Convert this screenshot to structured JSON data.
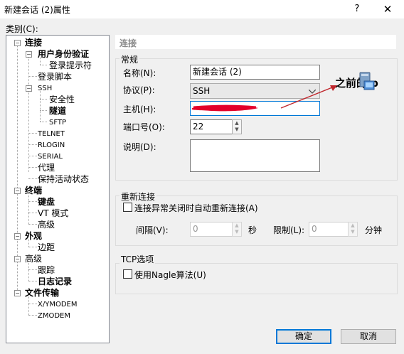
{
  "window": {
    "title": "新建会话 (2)属性",
    "help": "?",
    "close": "✕"
  },
  "category_label": "类别(C):",
  "tree": {
    "connection": "连接",
    "user_auth": "用户身份验证",
    "login_prompts": "登录提示符",
    "login_scripts": "登录脚本",
    "ssh": "SSH",
    "security": "安全性",
    "tunneling": "隧道",
    "sftp": "SFTP",
    "telnet": "TELNET",
    "rlogin": "RLOGIN",
    "serial": "SERIAL",
    "proxy": "代理",
    "keepalive": "保持活动状态",
    "terminal": "终端",
    "keyboard": "键盘",
    "vt_modes": "VT 模式",
    "advanced": "高级",
    "appearance": "外观",
    "margins": "边距",
    "advanced2": "高级",
    "trace": "跟踪",
    "logging": "日志记录",
    "file_transfer": "文件传输",
    "xymodem": "X/YMODEM",
    "zmodem": "ZMODEM"
  },
  "page_title": "连接",
  "general": {
    "group": "常规",
    "name_label": "名称(N):",
    "name_value": "新建会话 (2)",
    "protocol_label": "协议(P):",
    "protocol_value": "SSH",
    "host_label": "主机(H):",
    "host_value": "",
    "port_label": "端口号(O):",
    "port_value": "22",
    "desc_label": "说明(D):",
    "desc_value": ""
  },
  "annotation": "之前的ip",
  "reconnect": {
    "group": "重新连接",
    "checkbox": "连接异常关闭时自动重新连接(A)",
    "interval_label": "间隔(V):",
    "interval_value": "0",
    "seconds": "秒",
    "limit_label": "限制(L):",
    "limit_value": "0",
    "minutes": "分钟"
  },
  "tcp": {
    "group": "TCP选项",
    "checkbox": "使用Nagle算法(U)"
  },
  "buttons": {
    "ok": "确定",
    "cancel": "取消"
  },
  "colors": {
    "redaction": "#e3002b",
    "arrow": "#c0262c",
    "button_focus": "#0078d7"
  }
}
